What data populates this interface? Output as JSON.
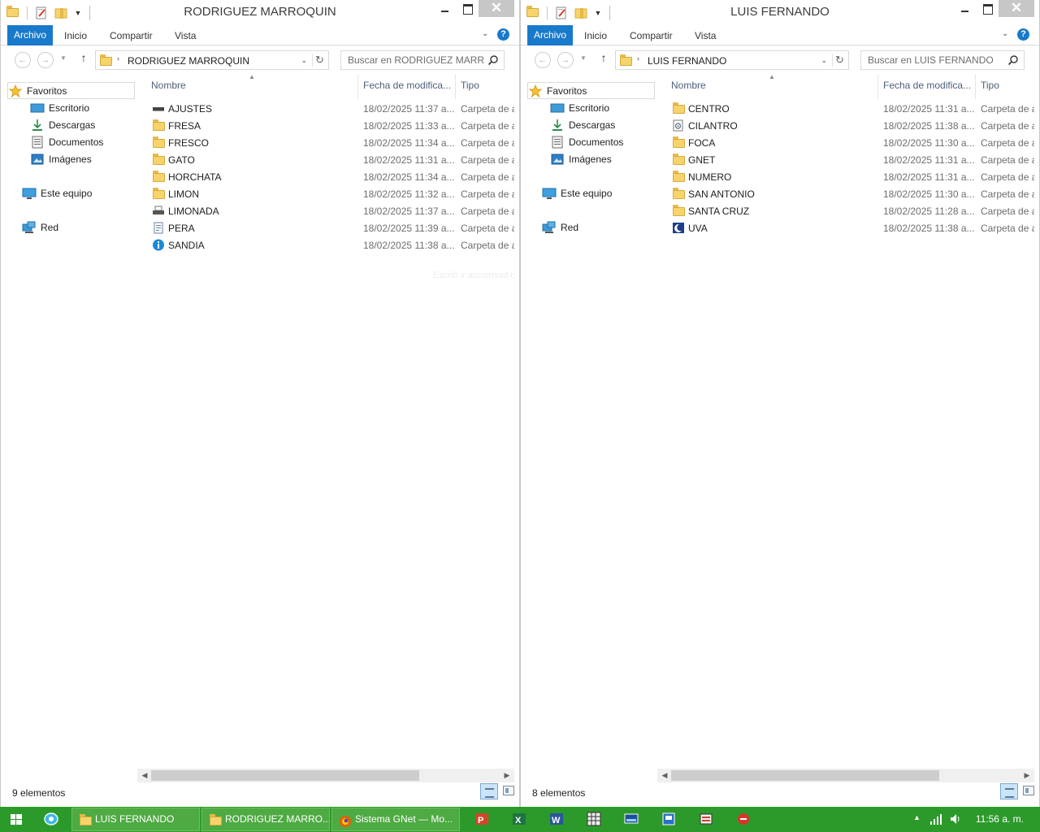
{
  "windows": [
    {
      "title": "RODRIGUEZ MARROQUIN",
      "ribbon": {
        "file": "Archivo",
        "home": "Inicio",
        "share": "Compartir",
        "view": "Vista"
      },
      "address": "RODRIGUEZ MARROQUIN",
      "search_placeholder": "Buscar en RODRIGUEZ MARR...",
      "nav": {
        "favorites": "Favoritos",
        "desktop": "Escritorio",
        "downloads": "Descargas",
        "documents": "Documentos",
        "images": "Imágenes",
        "this_pc": "Este equipo",
        "network": "Red"
      },
      "columns": {
        "name": "Nombre",
        "date": "Fecha de modifica...",
        "type": "Tipo"
      },
      "files": [
        {
          "name": "AJUSTES",
          "date": "18/02/2025 11:37 a...",
          "type": "Carpeta de a",
          "icon": "drive-icon"
        },
        {
          "name": "FRESA",
          "date": "18/02/2025 11:33 a...",
          "type": "Carpeta de a",
          "icon": "folder-icon"
        },
        {
          "name": "FRESCO",
          "date": "18/02/2025 11:34 a...",
          "type": "Carpeta de a",
          "icon": "folder-icon"
        },
        {
          "name": "GATO",
          "date": "18/02/2025 11:31 a...",
          "type": "Carpeta de a",
          "icon": "folder-icon"
        },
        {
          "name": "HORCHATA",
          "date": "18/02/2025 11:34 a...",
          "type": "Carpeta de a",
          "icon": "folder-icon"
        },
        {
          "name": "LIMON",
          "date": "18/02/2025 11:32 a...",
          "type": "Carpeta de a",
          "icon": "folder-icon"
        },
        {
          "name": "LIMONADA",
          "date": "18/02/2025 11:37 a...",
          "type": "Carpeta de a",
          "icon": "printer-icon"
        },
        {
          "name": "PERA",
          "date": "18/02/2025 11:39 a...",
          "type": "Carpeta de a",
          "icon": "document-icon"
        },
        {
          "name": "SANDIA",
          "date": "18/02/2025 11:38 a...",
          "type": "Carpeta de a",
          "icon": "info-icon"
        }
      ],
      "ghost_text": "Escrib ir accionsad dictado",
      "status": "9 elementos"
    },
    {
      "title": "LUIS FERNANDO",
      "ribbon": {
        "file": "Archivo",
        "home": "Inicio",
        "share": "Compartir",
        "view": "Vista"
      },
      "address": "LUIS FERNANDO",
      "search_placeholder": "Buscar en LUIS FERNANDO",
      "nav": {
        "favorites": "Favoritos",
        "desktop": "Escritorio",
        "downloads": "Descargas",
        "documents": "Documentos",
        "images": "Imágenes",
        "this_pc": "Este equipo",
        "network": "Red"
      },
      "columns": {
        "name": "Nombre",
        "date": "Fecha de modifica...",
        "type": "Tipo"
      },
      "files": [
        {
          "name": "CENTRO",
          "date": "18/02/2025 11:31 a...",
          "type": "Carpeta de a",
          "icon": "folder-icon"
        },
        {
          "name": "CILANTRO",
          "date": "18/02/2025 11:38 a...",
          "type": "Carpeta de a",
          "icon": "settings-file-icon"
        },
        {
          "name": "FOCA",
          "date": "18/02/2025 11:30 a...",
          "type": "Carpeta de a",
          "icon": "folder-icon"
        },
        {
          "name": "GNET",
          "date": "18/02/2025 11:31 a...",
          "type": "Carpeta de a",
          "icon": "folder-icon"
        },
        {
          "name": "NUMERO",
          "date": "18/02/2025 11:31 a...",
          "type": "Carpeta de a",
          "icon": "folder-icon"
        },
        {
          "name": "SAN ANTONIO",
          "date": "18/02/2025 11:30 a...",
          "type": "Carpeta de a",
          "icon": "folder-icon"
        },
        {
          "name": "SANTA CRUZ",
          "date": "18/02/2025 11:28 a...",
          "type": "Carpeta de a",
          "icon": "folder-icon"
        },
        {
          "name": "UVA",
          "date": "18/02/2025 11:38 a...",
          "type": "Carpeta de a",
          "icon": "moon-icon"
        }
      ],
      "status": "8 elementos"
    }
  ],
  "taskbar": {
    "buttons": [
      {
        "label": "LUIS FERNANDO",
        "icon": "folder-icon"
      },
      {
        "label": "RODRIGUEZ MARRO...",
        "icon": "folder-icon"
      },
      {
        "label": "Sistema GNet — Mo...",
        "icon": "firefox-icon"
      }
    ],
    "clock": "11:56 a. m."
  },
  "colors": {
    "accent": "#1979ca",
    "taskbar": "#2c9a2a",
    "taskbar_button": "#4eaa42",
    "folder": "#f7d36b"
  }
}
